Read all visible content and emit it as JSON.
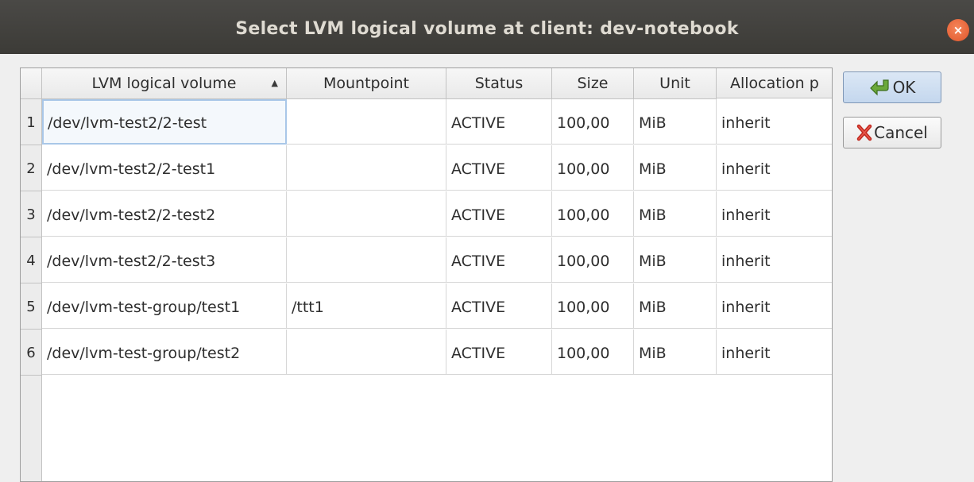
{
  "window": {
    "title": "Select LVM logical volume at client: dev-notebook",
    "close_glyph": "×"
  },
  "table": {
    "columns": [
      "LVM logical volume",
      "Mountpoint",
      "Status",
      "Size",
      "Unit",
      "Allocation p"
    ],
    "sort_indicator": "▲",
    "rows": [
      {
        "num": "1",
        "volume": "/dev/lvm-test2/2-test",
        "mountpoint": "",
        "status": "ACTIVE",
        "size": "100,00",
        "unit": "MiB",
        "allocation": "inherit"
      },
      {
        "num": "2",
        "volume": "/dev/lvm-test2/2-test1",
        "mountpoint": "",
        "status": "ACTIVE",
        "size": "100,00",
        "unit": "MiB",
        "allocation": "inherit"
      },
      {
        "num": "3",
        "volume": "/dev/lvm-test2/2-test2",
        "mountpoint": "",
        "status": "ACTIVE",
        "size": "100,00",
        "unit": "MiB",
        "allocation": "inherit"
      },
      {
        "num": "4",
        "volume": "/dev/lvm-test2/2-test3",
        "mountpoint": "",
        "status": "ACTIVE",
        "size": "100,00",
        "unit": "MiB",
        "allocation": "inherit"
      },
      {
        "num": "5",
        "volume": "/dev/lvm-test-group/test1",
        "mountpoint": "/ttt1",
        "status": "ACTIVE",
        "size": "100,00",
        "unit": "MiB",
        "allocation": "inherit"
      },
      {
        "num": "6",
        "volume": "/dev/lvm-test-group/test2",
        "mountpoint": "",
        "status": "ACTIVE",
        "size": "100,00",
        "unit": "MiB",
        "allocation": "inherit"
      }
    ]
  },
  "buttons": {
    "ok_label": "OK",
    "cancel_label": "Cancel"
  },
  "icons": {
    "ok": "green-arrow-icon",
    "cancel": "red-x-icon",
    "close": "close-icon",
    "sort": "sort-ascending-icon"
  },
  "colors": {
    "titlebar": "#3c3b37",
    "close": "#e95420",
    "selection": "#a9c7e8"
  }
}
